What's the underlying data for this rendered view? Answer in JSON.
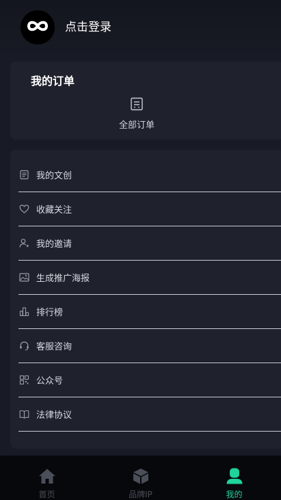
{
  "header": {
    "login_text": "点击登录",
    "avatar_icon": "infinity-logo-icon"
  },
  "orders": {
    "title": "我的订单",
    "all_orders_label": "全部订单",
    "all_orders_icon": "order-list-icon"
  },
  "menu": {
    "items": [
      {
        "label": "我的文创",
        "icon": "document-icon"
      },
      {
        "label": "收藏关注",
        "icon": "heart-icon"
      },
      {
        "label": "我的邀请",
        "icon": "user-add-icon"
      },
      {
        "label": "生成推广海报",
        "icon": "image-icon"
      },
      {
        "label": "排行榜",
        "icon": "ranking-icon"
      },
      {
        "label": "客服咨询",
        "icon": "headset-icon"
      },
      {
        "label": "公众号",
        "icon": "qrcode-icon"
      },
      {
        "label": "法律协议",
        "icon": "book-icon"
      }
    ]
  },
  "tabbar": {
    "tabs": [
      {
        "label": "首页",
        "icon": "home-icon",
        "active": false
      },
      {
        "label": "品牌IP",
        "icon": "cube-icon",
        "active": false
      },
      {
        "label": "我的",
        "icon": "profile-icon",
        "active": true
      }
    ],
    "active_color": "#1fd39a",
    "inactive_color": "#4a4e59"
  }
}
